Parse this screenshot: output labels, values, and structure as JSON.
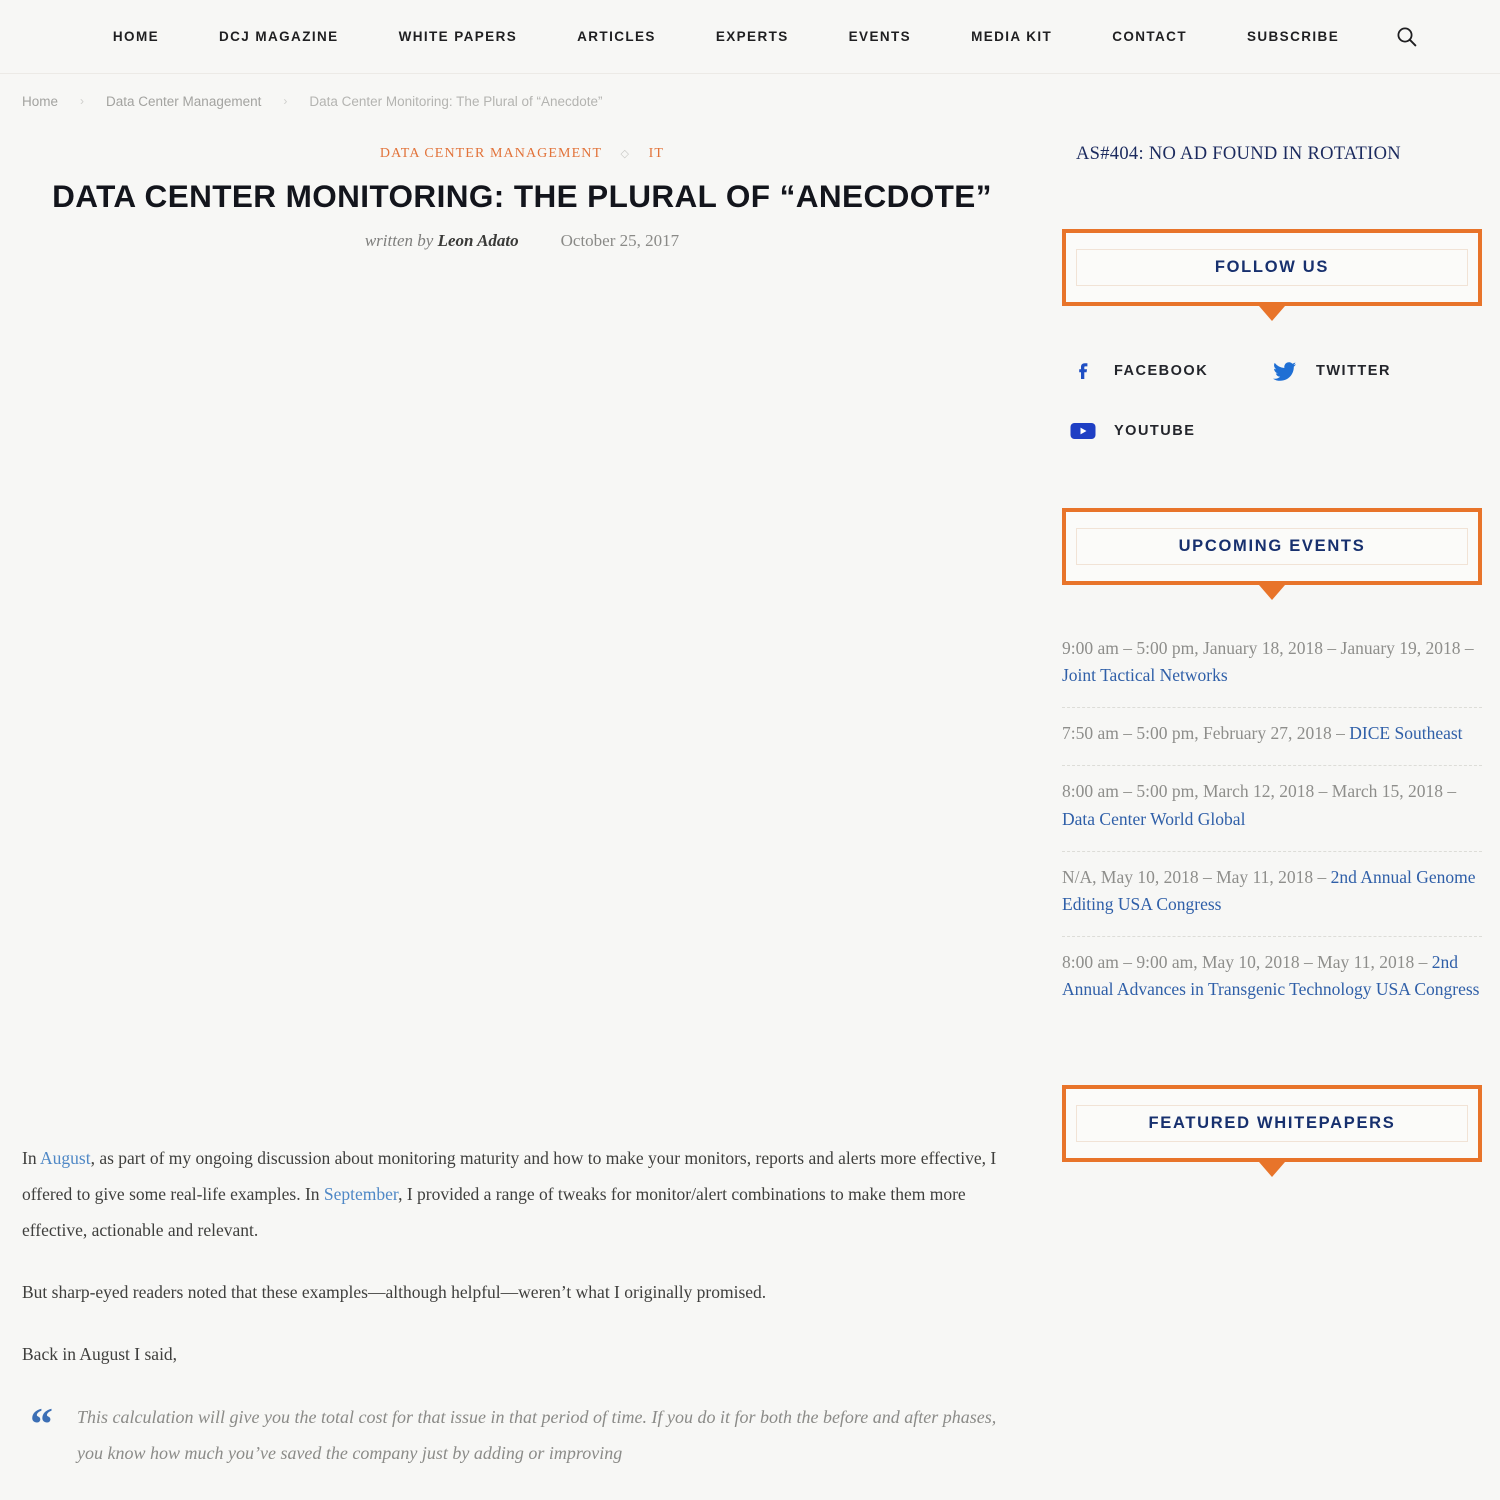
{
  "nav": {
    "items": [
      {
        "label": "HOME",
        "name": "nav-item-home"
      },
      {
        "label": "DCJ MAGAZINE",
        "name": "nav-item-dcj-magazine"
      },
      {
        "label": "WHITE PAPERS",
        "name": "nav-item-white-papers"
      },
      {
        "label": "ARTICLES",
        "name": "nav-item-articles"
      },
      {
        "label": "EXPERTS",
        "name": "nav-item-experts"
      },
      {
        "label": "EVENTS",
        "name": "nav-item-events"
      },
      {
        "label": "MEDIA KIT",
        "name": "nav-item-media-kit"
      },
      {
        "label": "CONTACT",
        "name": "nav-item-contact"
      },
      {
        "label": "SUBSCRIBE",
        "name": "nav-item-subscribe"
      }
    ],
    "search_icon": "search-icon"
  },
  "breadcrumb": {
    "home": "Home",
    "sep": "›",
    "category": "Data Center Management",
    "current": "Data Center Monitoring: The Plural of “Anecdote”"
  },
  "article": {
    "categories": {
      "primary": "DATA CENTER MANAGEMENT",
      "divider": "◇",
      "secondary": "IT"
    },
    "title": "DATA CENTER MONITORING: THE PLURAL OF “ANECDOTE”",
    "written_by": "written by",
    "author": "Leon Adato",
    "date": "October 25, 2017",
    "paragraphs": [
      {
        "id": "p1",
        "parts": [
          {
            "t": "In ",
            "link": false
          },
          {
            "t": "August",
            "link": true
          },
          {
            "t": ", as part of my ongoing discussion about monitoring maturity and how to make your monitors, reports and alerts more effective, I offered to give some real-life examples. In ",
            "link": false
          },
          {
            "t": "September",
            "link": true
          },
          {
            "t": ", I provided a range of tweaks for monitor/alert combinations to make them more effective, actionable and relevant.",
            "link": false
          }
        ]
      },
      {
        "id": "p2",
        "parts": [
          {
            "t": "But sharp-eyed readers noted that these examples—although helpful—weren’t what I originally promised.",
            "link": false
          }
        ]
      },
      {
        "id": "p3",
        "parts": [
          {
            "t": "Back in August I said,",
            "link": false
          }
        ]
      }
    ],
    "blockquote": {
      "mark": "“",
      "text": "This calculation will give you the total cost for that issue in that period of time. If you do it for both the before and after phases, you know how much you’ve saved the company just by adding or improving"
    }
  },
  "sidebar": {
    "ad_notice": "AS#404: NO AD FOUND IN ROTATION",
    "follow": {
      "title": "FOLLOW US",
      "items": [
        {
          "label": "FACEBOOK",
          "icon": "facebook-icon",
          "name": "social-link-facebook"
        },
        {
          "label": "TWITTER",
          "icon": "twitter-icon",
          "name": "social-link-twitter"
        },
        {
          "label": "YOUTUBE",
          "icon": "youtube-icon",
          "name": "social-link-youtube"
        }
      ]
    },
    "events": {
      "title": "UPCOMING EVENTS",
      "items": [
        {
          "when": "9:00 am – 5:00 pm, January 18, 2018 – January 19, 2018 – ",
          "name": "Joint Tactical Networks"
        },
        {
          "when": "7:50 am – 5:00 pm, February 27, 2018 – ",
          "name": "DICE Southeast"
        },
        {
          "when": "8:00 am – 5:00 pm, March 12, 2018 – March 15, 2018 – ",
          "name": "Data Center World Global"
        },
        {
          "when": "N/A, May 10, 2018 – May 11, 2018 – ",
          "name": "2nd Annual Genome Editing USA Congress"
        },
        {
          "when": "8:00 am – 9:00 am, May 10, 2018 – May 11, 2018 – ",
          "name": "2nd Annual Advances in Transgenic Technology USA Congress"
        }
      ]
    },
    "whitepapers": {
      "title": "FEATURED WHITEPAPERS"
    }
  },
  "colors": {
    "accent_orange": "#e8742a",
    "navy": "#17306e",
    "link_blue": "#2f5fa8",
    "body_link_blue": "#4f88c6",
    "category_orange": "#e2733a",
    "page_bg": "#f7f7f5"
  }
}
